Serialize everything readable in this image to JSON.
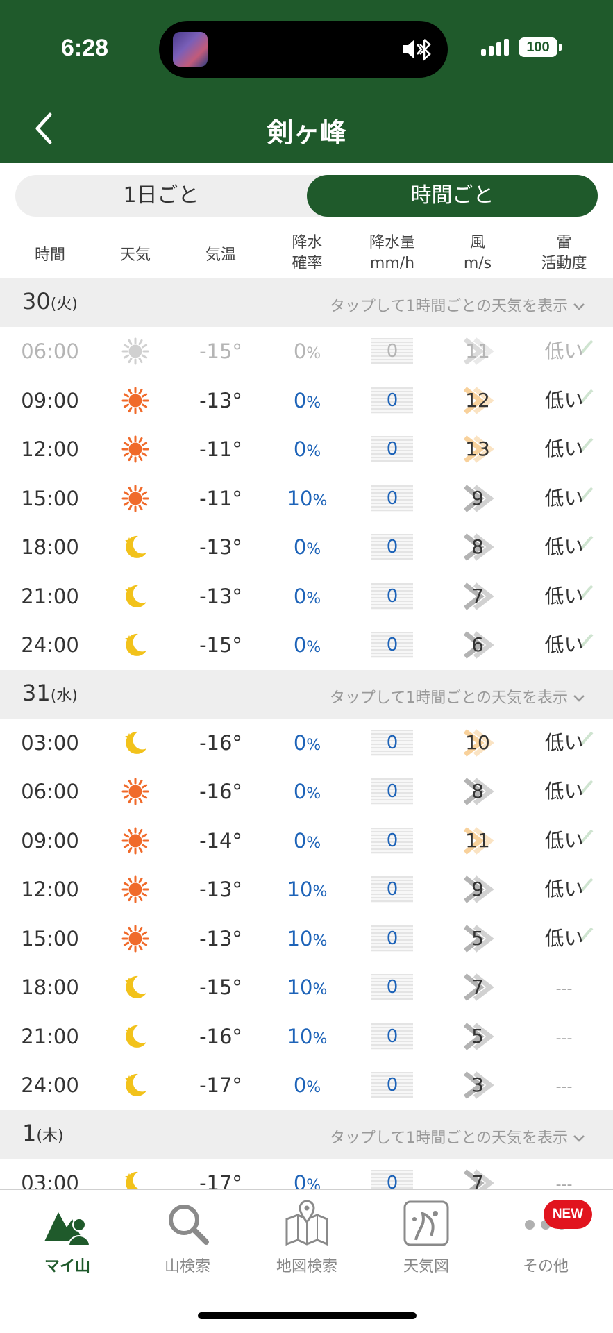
{
  "status_bar": {
    "time": "6:28",
    "battery": "100"
  },
  "header": {
    "title": "剣ヶ峰"
  },
  "segment": {
    "day": "1日ごと",
    "hour": "時間ごと"
  },
  "columns": {
    "time": "時間",
    "weather": "天気",
    "temp": "気温",
    "prob_1": "降水",
    "prob_2": "確率",
    "amount_1": "降水量",
    "amount_2": "mm/h",
    "wind_1": "風",
    "wind_2": "m/s",
    "thunder_1": "雷",
    "thunder_2": "活動度"
  },
  "days": [
    {
      "date": "30",
      "weekday": "(火)",
      "tap_text": "タップして1時間ごとの天気を表示",
      "rows": [
        {
          "time": "06:00",
          "icon": "sun-icon",
          "temp": "-15°",
          "prob": "0",
          "amount": "0",
          "wind": "11",
          "wind_level": "none",
          "thunder": "低い",
          "dim": true
        },
        {
          "time": "09:00",
          "icon": "sun-icon",
          "temp": "-13°",
          "prob": "0",
          "amount": "0",
          "wind": "12",
          "wind_level": "strong",
          "thunder": "低い"
        },
        {
          "time": "12:00",
          "icon": "sun-icon",
          "temp": "-11°",
          "prob": "0",
          "amount": "0",
          "wind": "13",
          "wind_level": "strong",
          "thunder": "低い"
        },
        {
          "time": "15:00",
          "icon": "sun-icon",
          "temp": "-11°",
          "prob": "10",
          "amount": "0",
          "wind": "9",
          "wind_level": "normal",
          "thunder": "低い"
        },
        {
          "time": "18:00",
          "icon": "moon-icon",
          "temp": "-13°",
          "prob": "0",
          "amount": "0",
          "wind": "8",
          "wind_level": "normal",
          "thunder": "低い"
        },
        {
          "time": "21:00",
          "icon": "moon-icon",
          "temp": "-13°",
          "prob": "0",
          "amount": "0",
          "wind": "7",
          "wind_level": "normal",
          "thunder": "低い"
        },
        {
          "time": "24:00",
          "icon": "moon-icon",
          "temp": "-15°",
          "prob": "0",
          "amount": "0",
          "wind": "6",
          "wind_level": "normal",
          "thunder": "低い"
        }
      ]
    },
    {
      "date": "31",
      "weekday": "(水)",
      "tap_text": "タップして1時間ごとの天気を表示",
      "rows": [
        {
          "time": "03:00",
          "icon": "moon-icon",
          "temp": "-16°",
          "prob": "0",
          "amount": "0",
          "wind": "10",
          "wind_level": "strong",
          "thunder": "低い"
        },
        {
          "time": "06:00",
          "icon": "sun-icon",
          "temp": "-16°",
          "prob": "0",
          "amount": "0",
          "wind": "8",
          "wind_level": "normal",
          "thunder": "低い"
        },
        {
          "time": "09:00",
          "icon": "sun-icon",
          "temp": "-14°",
          "prob": "0",
          "amount": "0",
          "wind": "11",
          "wind_level": "strong",
          "thunder": "低い"
        },
        {
          "time": "12:00",
          "icon": "sun-icon",
          "temp": "-13°",
          "prob": "10",
          "amount": "0",
          "wind": "9",
          "wind_level": "normal",
          "thunder": "低い"
        },
        {
          "time": "15:00",
          "icon": "sun-icon",
          "temp": "-13°",
          "prob": "10",
          "amount": "0",
          "wind": "5",
          "wind_level": "normal",
          "thunder": "低い"
        },
        {
          "time": "18:00",
          "icon": "moon-icon",
          "temp": "-15°",
          "prob": "10",
          "amount": "0",
          "wind": "7",
          "wind_level": "normal",
          "thunder": "---"
        },
        {
          "time": "21:00",
          "icon": "moon-icon",
          "temp": "-16°",
          "prob": "10",
          "amount": "0",
          "wind": "5",
          "wind_level": "normal",
          "thunder": "---"
        },
        {
          "time": "24:00",
          "icon": "moon-icon",
          "temp": "-17°",
          "prob": "0",
          "amount": "0",
          "wind": "3",
          "wind_level": "normal",
          "thunder": "---"
        }
      ]
    },
    {
      "date": "1",
      "weekday": "(木)",
      "tap_text": "タップして1時間ごとの天気を表示",
      "rows": [
        {
          "time": "03:00",
          "icon": "moon-icon",
          "temp": "-17°",
          "prob": "0",
          "amount": "0",
          "wind": "7",
          "wind_level": "normal",
          "thunder": "---"
        }
      ]
    }
  ],
  "percent_sign": "%",
  "nav": [
    {
      "label": "マイ山",
      "icon": "mountain-person-icon",
      "active": true
    },
    {
      "label": "山検索",
      "icon": "search-icon"
    },
    {
      "label": "地図検索",
      "icon": "map-pin-icon"
    },
    {
      "label": "天気図",
      "icon": "weather-map-icon"
    },
    {
      "label": "その他",
      "icon": "more-dots-icon",
      "badge": "NEW"
    }
  ],
  "colors": {
    "brand_green": "#1f5a2b",
    "rain_blue": "#1d63b8",
    "sun_orange": "#f06a2a",
    "moon_yellow": "#f2c21b",
    "strong_wind": "#f5c27a",
    "new_badge": "#e1141e"
  }
}
